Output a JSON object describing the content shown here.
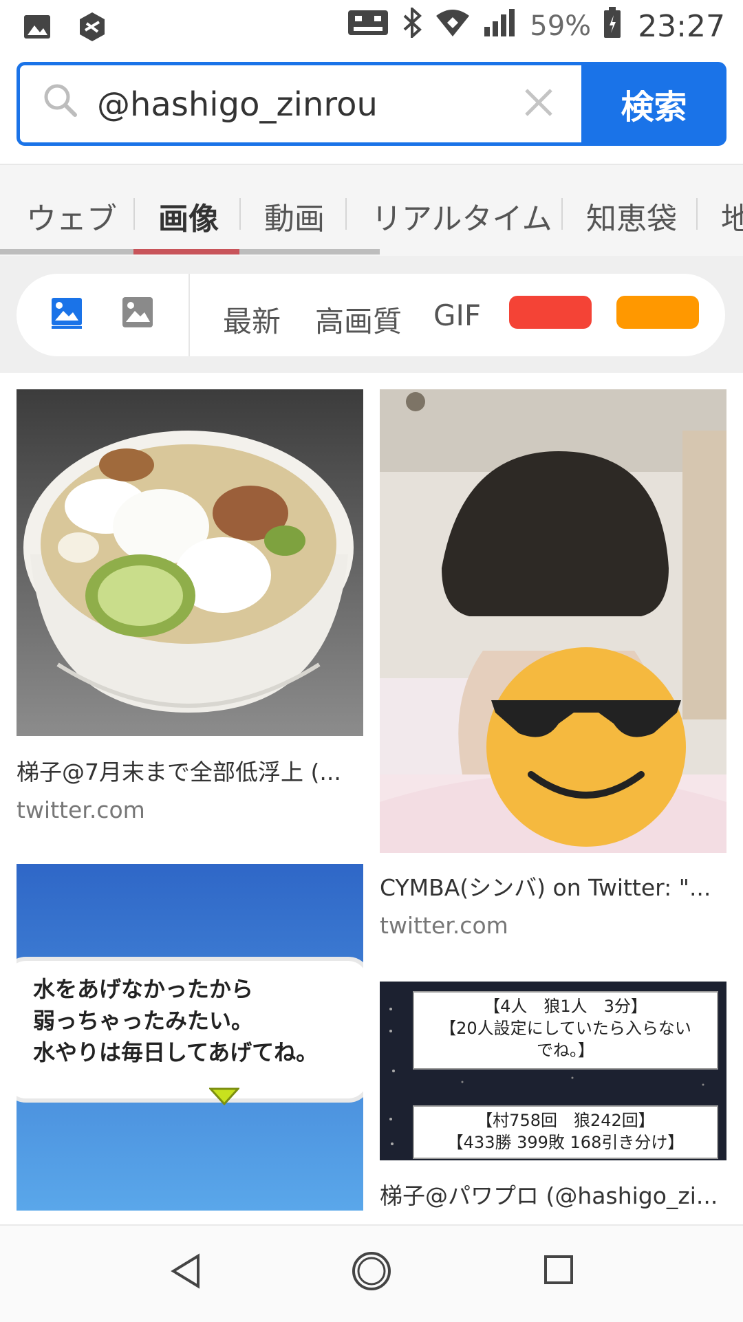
{
  "status_bar": {
    "battery_percent": "59%",
    "time": "23:27"
  },
  "search": {
    "query": "@hashigo_zinrou",
    "button_label": "検索"
  },
  "tabs": [
    {
      "label": "ウェブ"
    },
    {
      "label": "画像"
    },
    {
      "label": "動画"
    },
    {
      "label": "リアルタイム"
    },
    {
      "label": "知恵袋"
    },
    {
      "label": "地"
    }
  ],
  "active_tab": "画像",
  "filters": {
    "labels": [
      "最新",
      "高画質",
      "GIF"
    ],
    "color_swatches": [
      "#f44336",
      "#ff9800"
    ],
    "accent": "#1a73e8"
  },
  "results": [
    {
      "title": "梯子@7月末まで全部低浮上 (...",
      "domain": "twitter.com"
    },
    {
      "title": "CYMBA(シンバ) on Twitter: \"...",
      "domain": "twitter.com"
    },
    {
      "title": "梯子@パワプロ (@hashigo_zi...",
      "image_text": {
        "box1": [
          "【4人　狼1人　3分】",
          "【20人設定にしていたら入らない",
          "でね。】"
        ],
        "box2": [
          "【村758回　狼242回】",
          "【433勝 399敗 168引き分け】"
        ]
      }
    },
    {
      "image_text": [
        "水をあげなかったから",
        "弱っちゃったみたい。",
        "水やりは毎日してあげてね。"
      ]
    }
  ]
}
